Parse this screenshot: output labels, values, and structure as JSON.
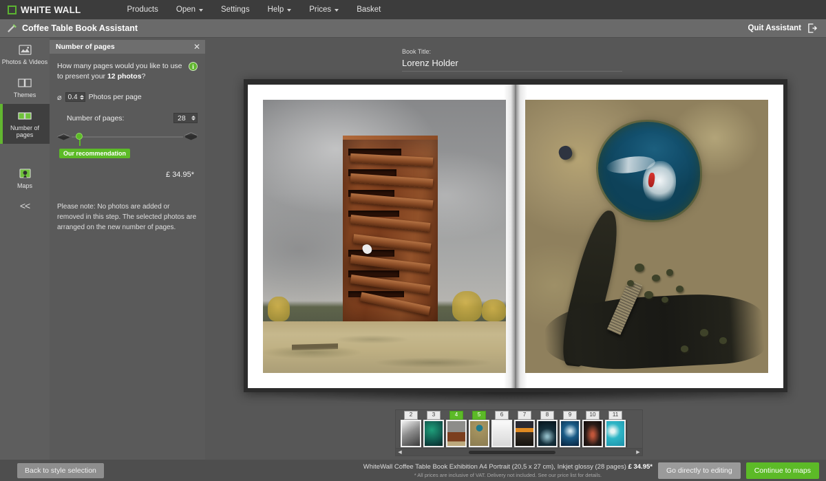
{
  "topbar": {
    "logo_text": "WHITE WALL",
    "nav": [
      {
        "label": "Products",
        "has_caret": false
      },
      {
        "label": "Open",
        "has_caret": true
      },
      {
        "label": "Settings",
        "has_caret": false
      },
      {
        "label": "Help",
        "has_caret": true
      },
      {
        "label": "Prices",
        "has_caret": true
      },
      {
        "label": "Basket",
        "has_caret": false
      }
    ]
  },
  "assistant_bar": {
    "title": "Coffee Table Book Assistant",
    "quit_label": "Quit Assistant"
  },
  "sidebar": {
    "items": [
      {
        "label": "Photos & Videos",
        "icon": "image-icon",
        "active": false
      },
      {
        "label": "Themes",
        "icon": "open-book-icon",
        "active": false
      },
      {
        "label": "Number of pages",
        "icon": "two-pages-icon",
        "active": true
      },
      {
        "label": "Maps",
        "icon": "map-pin-icon",
        "active": false
      }
    ],
    "collapse_label": "<<"
  },
  "panel": {
    "title": "Number of pages",
    "close_label": "✕",
    "question_prefix": "How many pages would you like to use to present your ",
    "question_bold": "12 photos",
    "question_suffix": "?",
    "info_label": "i",
    "photos_per_page_symbol": "⌀",
    "photos_per_page_value": "0.4",
    "photos_per_page_label": "Photos per page",
    "number_of_pages_label": "Number of pages:",
    "number_of_pages_value": "28",
    "recommendation_label": "Our recommendation",
    "price": "£ 34.95*",
    "note": "Please note: No photos are added or removed in this step. The selected photos are arranged on the new number of pages."
  },
  "stage": {
    "book_title_label": "Book Title:",
    "book_title_value": "Lorenz Holder",
    "left_page_alt": "Rust-coloured corten steel viewing tower with zigzag staircases under grey clouds",
    "right_page_alt": "Aerial view of a person in red leaping into a turquoise pond surrounded by dry grass"
  },
  "filmstrip": {
    "thumbs": [
      {
        "num": "2",
        "selected": false
      },
      {
        "num": "3",
        "selected": false
      },
      {
        "num": "4",
        "selected": true
      },
      {
        "num": "5",
        "selected": true
      },
      {
        "num": "6",
        "selected": false
      },
      {
        "num": "7",
        "selected": false
      },
      {
        "num": "8",
        "selected": false
      },
      {
        "num": "9",
        "selected": false
      },
      {
        "num": "10",
        "selected": false
      },
      {
        "num": "11",
        "selected": false
      }
    ],
    "scroll_left": "◀",
    "scroll_right": "▶"
  },
  "bottombar": {
    "back_label": "Back to style selection",
    "product_line_prefix": "WhiteWall Coffee Table Book Exhibition A4 Portrait (20,5 x 27 cm), Inkjet glossy (28 pages) ",
    "product_price": "£ 34.95*",
    "disclaimer": "* All prices are inclusive of VAT. Delivery not included. See our price list for details.",
    "edit_label": "Go directly to editing",
    "continue_label": "Continue to maps"
  },
  "colors": {
    "accent_green": "#5cba27",
    "topbar_bg": "#3c3c3c",
    "panel_bg": "#5a5a5a",
    "stage_bg": "#575757"
  }
}
